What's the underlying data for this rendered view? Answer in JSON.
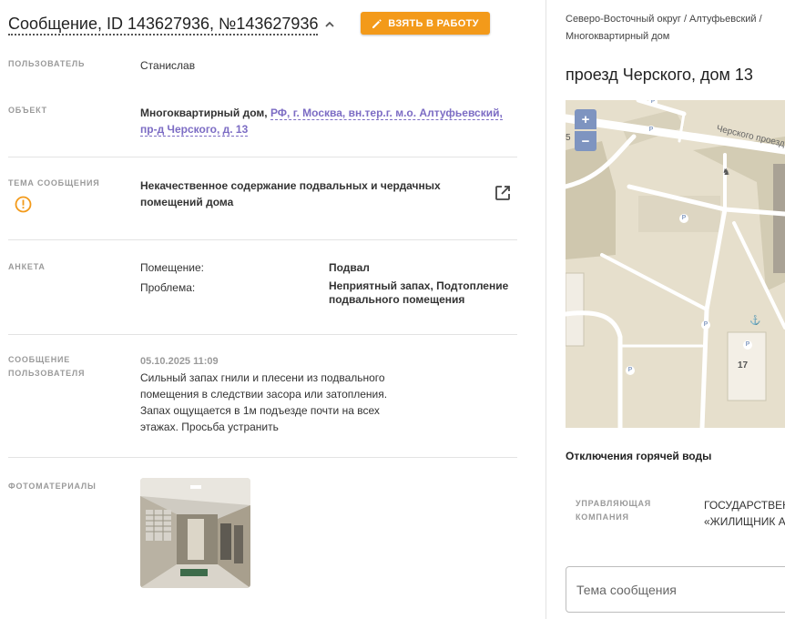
{
  "header": {
    "title": "Сообщение, ID 143627936, №143627936",
    "take_button": "ВЗЯТЬ В РАБОТУ",
    "accent": "#f39a1a"
  },
  "fields": {
    "user": {
      "label": "ПОЛЬЗОВАТЕЛЬ",
      "value": "Станислав"
    },
    "object": {
      "label": "ОБЪЕКТ",
      "type": "Многоквартирный дом,",
      "address_line1": "РФ, г. Москва, вн.тер.г. м.о. Алтуфьевский,",
      "address_line2": "пр-д Черского, д. 13"
    },
    "topic": {
      "label": "ТЕМА СООБЩЕНИЯ",
      "line1": "Некачественное содержание подвальных и чердачных",
      "line2": "помещений дома",
      "icon": "warning-circle-icon",
      "action_icon": "open-external-icon"
    },
    "survey": {
      "label": "АНКЕТА",
      "rows": [
        {
          "key": "Помещение:",
          "value": [
            "Подвал"
          ]
        },
        {
          "key": "Проблема:",
          "value": [
            "Неприятный запах, Подтопление",
            "подвального помещения"
          ]
        }
      ]
    },
    "message": {
      "label_line1": "СООБЩЕНИЕ",
      "label_line2": "ПОЛЬЗОВАТЕЛЯ",
      "date": "05.10.2025 11:09",
      "lines": [
        "Сильный запах гнили и плесени из подвального",
        "помещения в следствии засора или затопления.",
        "Запах ощущается в 1м подъезде почти на всех",
        "этажах. Просьба устранить"
      ]
    },
    "photos": {
      "label": "ФОТОМАТЕРИАЛЫ"
    }
  },
  "right": {
    "breadcrumb_line1": "Северо-Восточный округ / Алтуфьевский /",
    "breadcrumb_line2": "Многоквартирный дом",
    "address": "проезд Черского, дом 13",
    "map": {
      "zoom_in": "+",
      "zoom_out": "−",
      "street_label": "Черского проезд",
      "house_number": "17",
      "edge_number": "5",
      "parking": "P"
    },
    "outage": "Отключения горячей воды",
    "management_label_line1": "УПРАВЛЯЮЩАЯ",
    "management_label_line2": "КОМПАНИЯ",
    "management_line1": "ГОСУДАРСТВЕН",
    "management_line2": "«ЖИЛИЩНИК А",
    "subject_placeholder": "Тема сообщения"
  }
}
